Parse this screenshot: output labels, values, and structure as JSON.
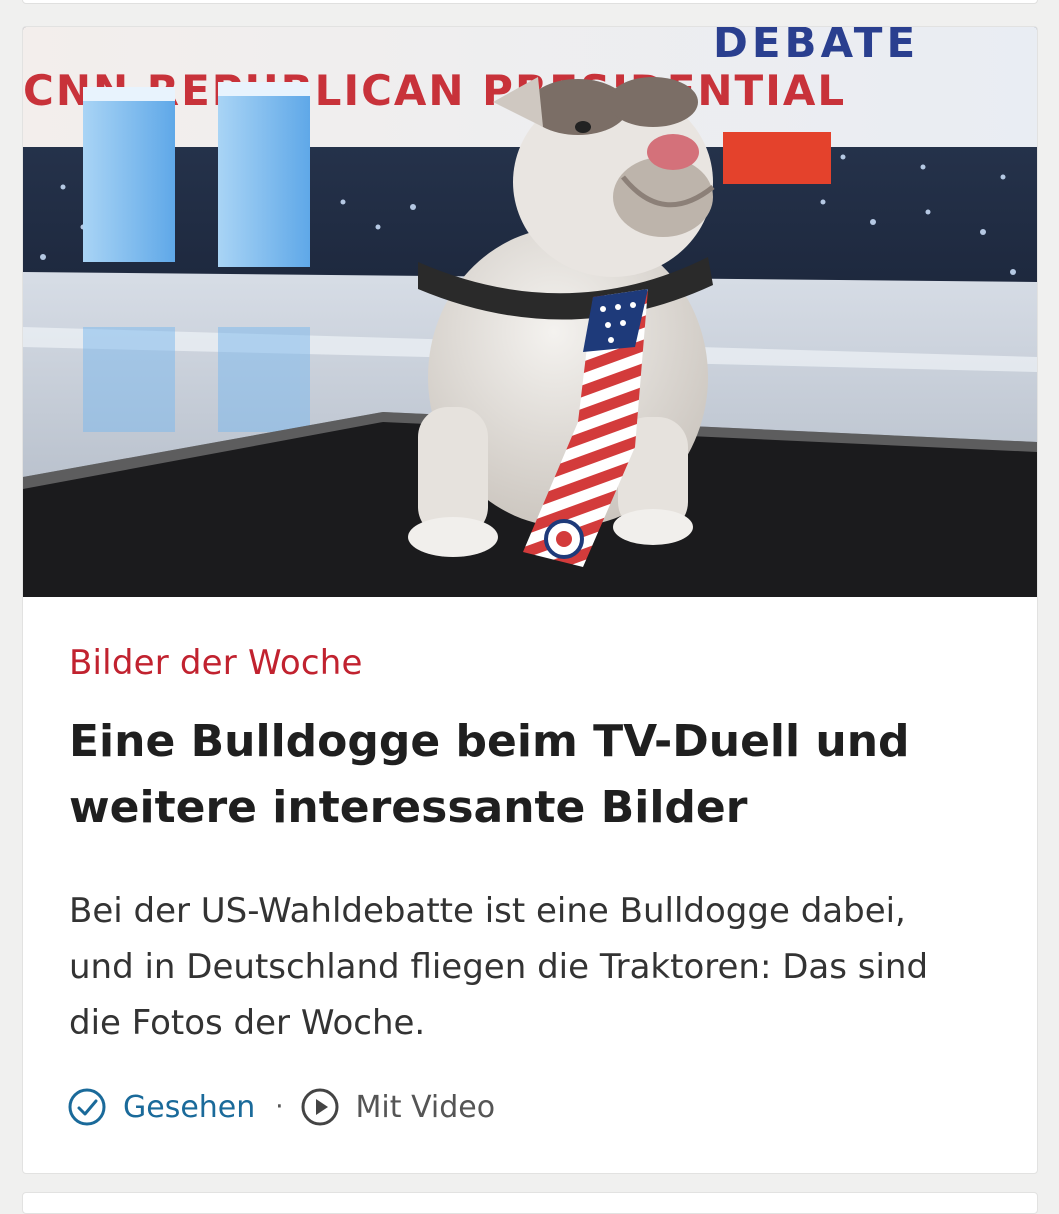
{
  "teaser": {
    "kicker": "Bilder der Woche",
    "headline": "Eine Bulldogge beim TV-Duell und weitere interessante Bilder",
    "text": "Bei der US-Wahldebatte ist eine Bulldogge dabei, und in Deutschland fliegen die Traktoren: Das sind die Fotos der Woche.",
    "banner_text": "CNN REPUBLICAN PRESIDENTIAL DEBATE",
    "image_icon": "bulldog-with-flag-tie-photo"
  },
  "meta": {
    "seen_label": "Gesehen",
    "seen_icon": "check-circle-icon",
    "separator": "·",
    "video_label": "Mit Video",
    "video_icon": "play-circle-icon"
  },
  "colors": {
    "kicker": "#c1222f",
    "seen": "#1a6a9a",
    "background": "#f0f0ef",
    "card": "#ffffff"
  }
}
